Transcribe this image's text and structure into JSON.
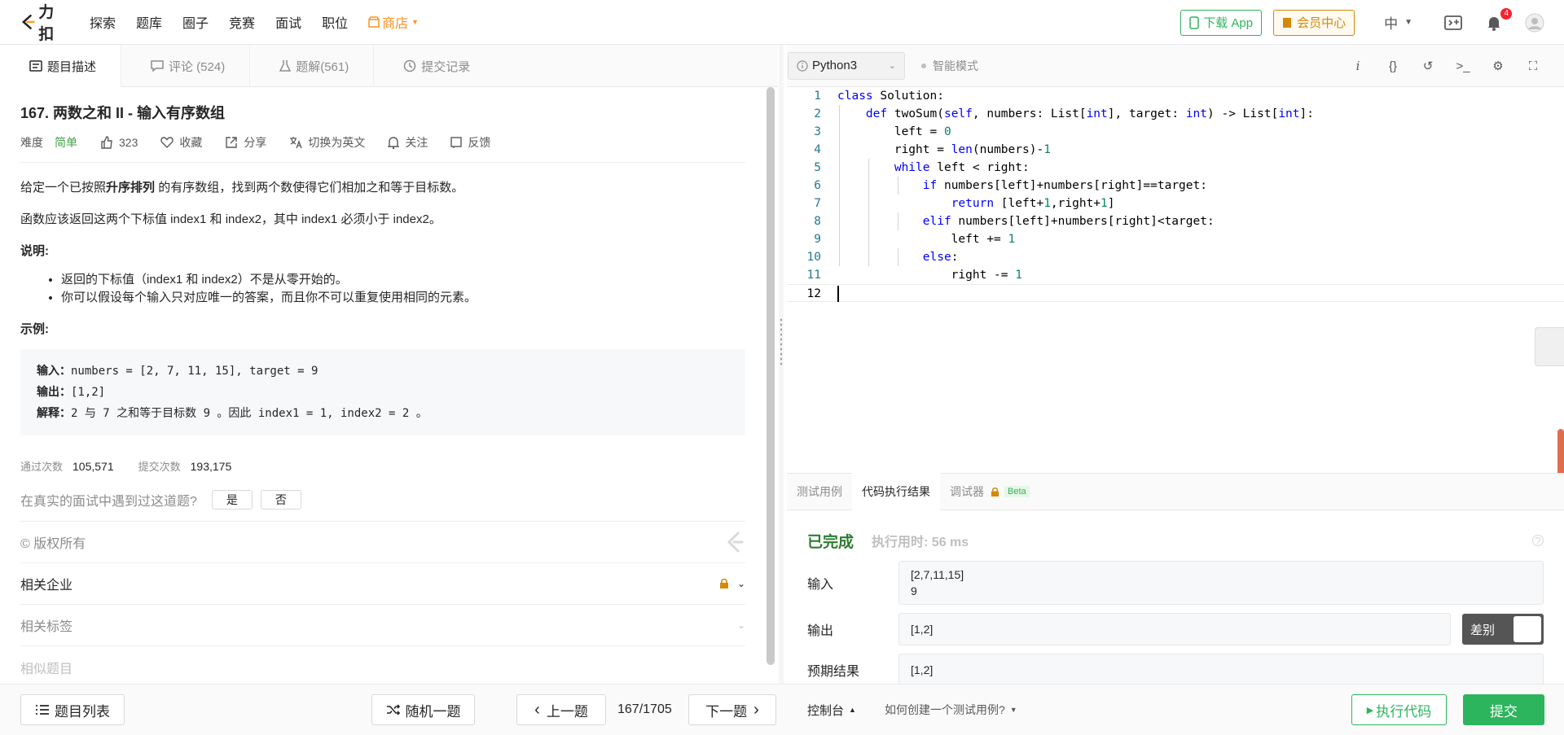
{
  "topnav": {
    "logo_text": "力扣",
    "items": [
      "探索",
      "题库",
      "圈子",
      "竞赛",
      "面试",
      "职位"
    ],
    "shop_label": "商店",
    "download_label": "下载 App",
    "vip_label": "会员中心",
    "lang": "中",
    "notif_count": "4",
    "brand_color": "#2db55d"
  },
  "left_tabs": [
    {
      "label": "题目描述",
      "icon": "doc-icon"
    },
    {
      "label": "评论 (524)",
      "icon": "comment-icon"
    },
    {
      "label": "题解(561)",
      "icon": "flask-icon"
    },
    {
      "label": "提交记录",
      "icon": "clock-icon"
    }
  ],
  "question": {
    "title": "167. 两数之和 II - 输入有序数组",
    "difficulty_label": "难度",
    "difficulty": "简单",
    "likes": "323",
    "favorite": "收藏",
    "share": "分享",
    "switch_en": "切换为英文",
    "follow": "关注",
    "feedback": "反馈",
    "p1_pre": "给定一个已按照",
    "p1_bold": "升序排列",
    "p1_post": " 的有序数组，找到两个数使得它们相加之和等于目标数。",
    "p2": "函数应该返回这两个下标值 index1 和 index2，其中 index1 必须小于 index2。",
    "note_head": "说明:",
    "notes": [
      "返回的下标值（index1 和 index2）不是从零开始的。",
      "你可以假设每个输入只对应唯一的答案，而且你不可以重复使用相同的元素。"
    ],
    "example_head": "示例:",
    "ex_input_label": "输入：",
    "ex_input": "numbers = [2, 7, 11, 15], target = 9",
    "ex_output_label": "输出：",
    "ex_output": "[1,2]",
    "ex_explain_label": "解释：",
    "ex_explain": "2 与 7 之和等于目标数 9 。因此 index1 = 1, index2 = 2 。",
    "accepted_label": "通过次数",
    "accepted": "105,571",
    "submissions_label": "提交次数",
    "submissions": "193,175",
    "interview_q": "在真实的面试中遇到过这道题?",
    "yes": "是",
    "no": "否",
    "copyright": "© 版权所有",
    "companies": "相关企业",
    "tags": "相关标签",
    "similar": "相似题目"
  },
  "editor": {
    "language": "Python3",
    "smart_mode": "智能模式",
    "lines": [
      "1",
      "2",
      "3",
      "4",
      "5",
      "6",
      "7",
      "8",
      "9",
      "10",
      "11",
      "12"
    ]
  },
  "result_tabs": [
    "测试用例",
    "代码执行结果",
    "调试器"
  ],
  "beta": "Beta",
  "result": {
    "status": "已完成",
    "runtime": "执行用时: 56 ms",
    "input_label": "输入",
    "input_l1": "[2,7,11,15]",
    "input_l2": "9",
    "output_label": "输出",
    "output": "[1,2]",
    "diff_label": "差别",
    "expected_label": "预期结果",
    "expected": "[1,2]"
  },
  "bottom": {
    "list": "题目列表",
    "random": "随机一题",
    "prev": "上一题",
    "page": "167/1705",
    "next": "下一题",
    "console": "控制台",
    "howto": "如何创建一个测试用例?",
    "run": "执行代码",
    "submit": "提交"
  }
}
